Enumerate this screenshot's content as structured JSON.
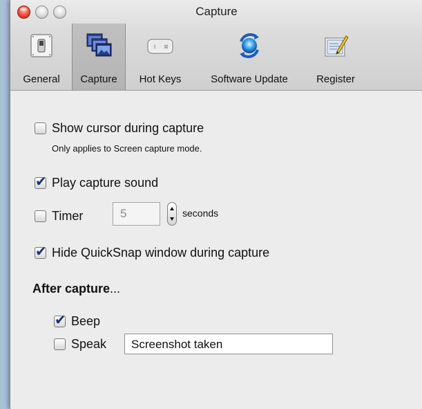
{
  "window": {
    "title": "Capture"
  },
  "toolbar": {
    "items": [
      {
        "label": "General",
        "icon": "switch-icon",
        "selected": false
      },
      {
        "label": "Capture",
        "icon": "screenshots-icon",
        "selected": true
      },
      {
        "label": "Hot Keys",
        "icon": "keyboard-key-icon",
        "selected": false
      },
      {
        "label": "Software Update",
        "icon": "update-arrows-icon",
        "selected": false
      },
      {
        "label": "Register",
        "icon": "certificate-pen-icon",
        "selected": false
      }
    ]
  },
  "capture": {
    "show_cursor": {
      "label": "Show cursor during capture",
      "checked": false,
      "note": "Only applies to Screen capture mode."
    },
    "play_sound": {
      "label": "Play capture sound",
      "checked": true
    },
    "timer": {
      "label": "Timer",
      "checked": false,
      "value": "5",
      "unit": "seconds"
    },
    "hide_window": {
      "label": "Hide QuickSnap window during capture",
      "checked": true
    },
    "after_capture": {
      "heading": "After capture",
      "heading_suffix": "...",
      "beep": {
        "label": "Beep",
        "checked": true
      },
      "speak": {
        "label": "Speak",
        "checked": false,
        "text": "Screenshot taken"
      }
    }
  },
  "colors": {
    "desktop": "#a9c1d8",
    "window": "#ececec",
    "check": "#1b2f7a",
    "close_button": "#ee4a3b"
  }
}
